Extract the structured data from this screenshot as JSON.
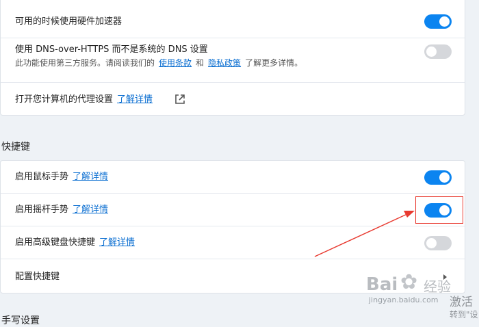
{
  "card1": {
    "hw_accel_label": "可用的时候使用硬件加速器",
    "hw_accel_on": true,
    "doh_label": "使用 DNS-over-HTTPS 而不是系统的 DNS 设置",
    "doh_desc_prefix": "此功能使用第三方服务。请阅读我们的",
    "doh_link_terms": "使用条款",
    "doh_desc_and": "和",
    "doh_link_privacy": "隐私政策",
    "doh_desc_suffix": "了解更多详情。",
    "doh_on": false,
    "proxy_label": "打开您计算机的代理设置",
    "proxy_link": "了解详情"
  },
  "shortcuts": {
    "section_title": "快捷键",
    "mouse_label": "启用鼠标手势",
    "mouse_link": "了解详情",
    "mouse_on": true,
    "rocker_label": "启用摇杆手势",
    "rocker_link": "了解详情",
    "rocker_on": true,
    "advanced_label": "启用高级键盘快捷键",
    "advanced_link": "了解详情",
    "advanced_on": false,
    "configure_label": "配置快捷键"
  },
  "next_section_partial": "手写设置",
  "watermark": {
    "brand": "Bai",
    "brand_suffix": "经验",
    "url": "jingyan.baidu.com",
    "activate": "激活",
    "activate_sub": "转到\"设"
  },
  "colors": {
    "toggle_on": "#0b84f0",
    "toggle_off": "#d5d7db",
    "link": "#0a6ed1",
    "annotation": "#e8392f"
  }
}
